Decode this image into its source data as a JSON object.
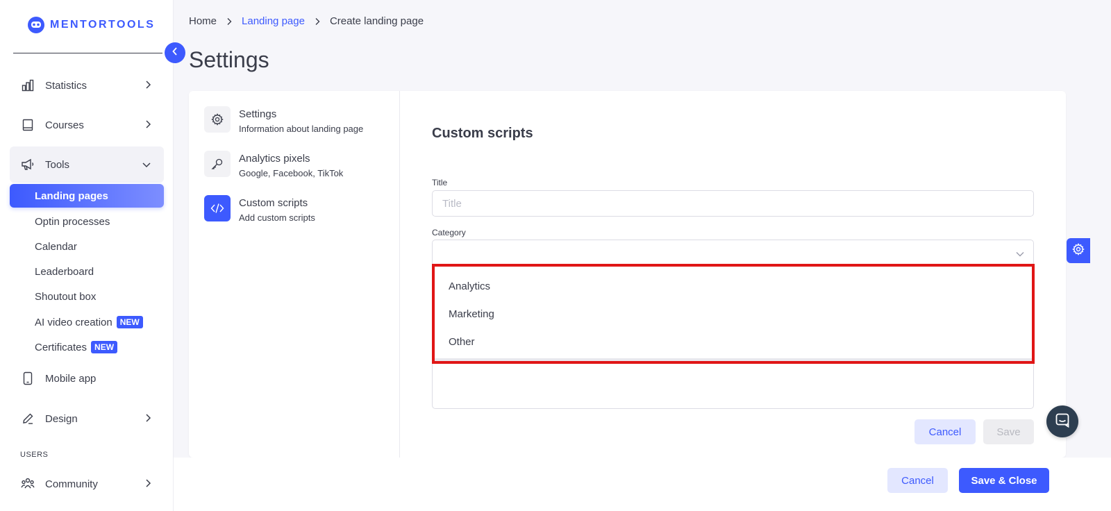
{
  "brand": {
    "name": "MENTORTOOLS"
  },
  "sidebar": {
    "items": [
      {
        "label": "Statistics",
        "icon": "bar-chart-icon"
      },
      {
        "label": "Courses",
        "icon": "book-icon"
      },
      {
        "label": "Tools",
        "icon": "megaphone-icon"
      },
      {
        "label": "Mobile app",
        "icon": "mobile-icon"
      },
      {
        "label": "Design",
        "icon": "pen-icon"
      },
      {
        "label": "Community",
        "icon": "people-icon"
      }
    ],
    "tools_sub": [
      {
        "label": "Landing pages"
      },
      {
        "label": "Optin processes"
      },
      {
        "label": "Calendar"
      },
      {
        "label": "Leaderboard"
      },
      {
        "label": "Shoutout box"
      },
      {
        "label": "AI video creation",
        "badge": "NEW"
      },
      {
        "label": "Certificates",
        "badge": "NEW"
      }
    ],
    "section_users": "USERS"
  },
  "breadcrumb": [
    "Home",
    "Landing page",
    "Create landing page"
  ],
  "page": {
    "title": "Settings"
  },
  "settings_tabs": [
    {
      "title": "Settings",
      "subtitle": "Information about landing page",
      "icon": "gear-icon"
    },
    {
      "title": "Analytics pixels",
      "subtitle": "Google, Facebook, TikTok",
      "icon": "key-icon"
    },
    {
      "title": "Custom scripts",
      "subtitle": "Add custom scripts",
      "icon": "code-icon"
    }
  ],
  "form": {
    "title": "Custom scripts",
    "title_label": "Title",
    "title_placeholder": "Title",
    "category_label": "Category",
    "category_options": [
      "Analytics",
      "Marketing",
      "Other"
    ],
    "cancel": "Cancel",
    "save": "Save"
  },
  "footer": {
    "cancel": "Cancel",
    "save_close": "Save & Close"
  },
  "colors": {
    "accent": "#3d5afe",
    "highlight": "#e01616",
    "chat": "#2d3e50"
  }
}
